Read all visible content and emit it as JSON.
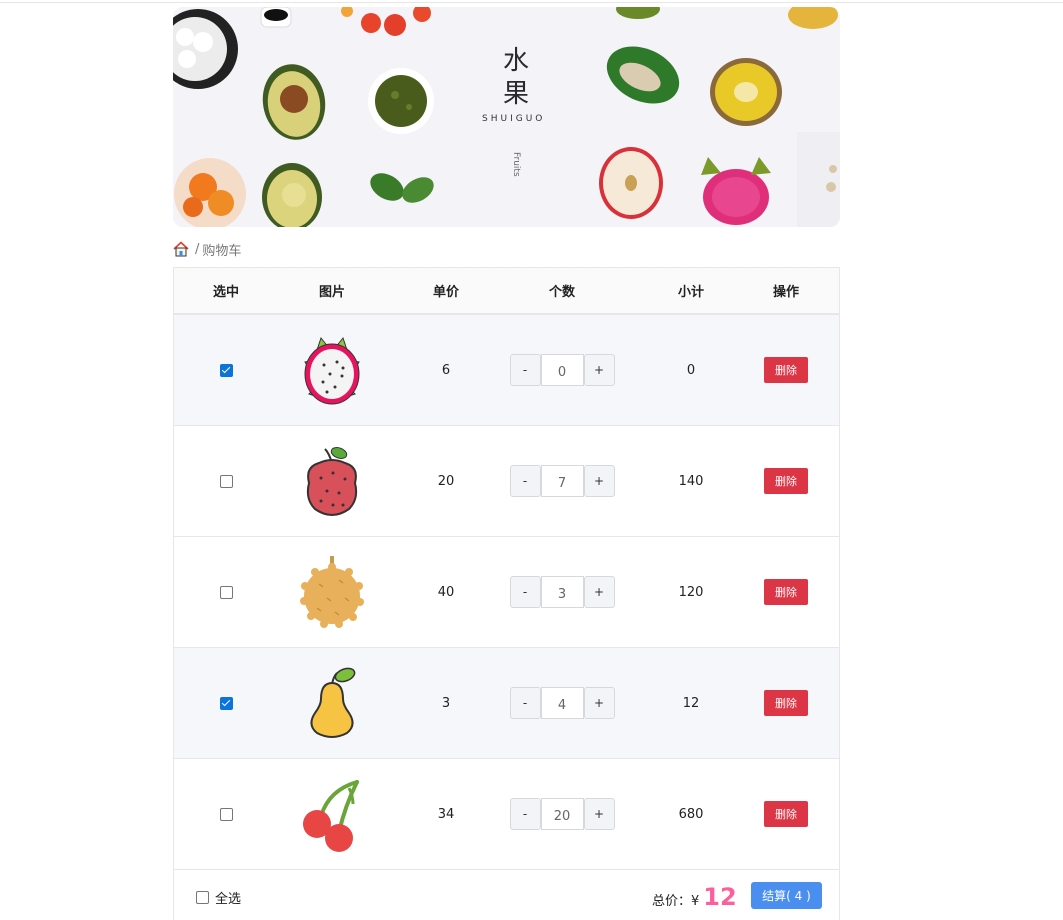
{
  "banner": {
    "title_line1": "水",
    "title_line2": "果",
    "subtitle": "SHUIGUO",
    "vertical_text": "Fruits"
  },
  "breadcrumb": {
    "home_icon": "home-icon",
    "separator": "/",
    "current": "购物车"
  },
  "table": {
    "headers": [
      "选中",
      "图片",
      "单价",
      "个数",
      "小计",
      "操作"
    ],
    "rows": [
      {
        "checked": true,
        "fruit": "dragon-fruit",
        "price": "6",
        "qty": "0",
        "subtotal": "0",
        "delete_label": "删除",
        "striped": true
      },
      {
        "checked": false,
        "fruit": "lychee",
        "price": "20",
        "qty": "7",
        "subtotal": "140",
        "delete_label": "删除",
        "striped": false
      },
      {
        "checked": false,
        "fruit": "durian",
        "price": "40",
        "qty": "3",
        "subtotal": "120",
        "delete_label": "删除",
        "striped": false
      },
      {
        "checked": true,
        "fruit": "pear",
        "price": "3",
        "qty": "4",
        "subtotal": "12",
        "delete_label": "删除",
        "striped": true
      },
      {
        "checked": false,
        "fruit": "cherry",
        "price": "34",
        "qty": "20",
        "subtotal": "680",
        "delete_label": "删除",
        "striped": false
      }
    ],
    "minus_label": "-",
    "plus_label": "+"
  },
  "footer": {
    "select_all_label": "全选",
    "select_all_checked": false,
    "total_label": "总价：¥",
    "total_amount": "12",
    "checkout_label": "结算( 4 )"
  },
  "colors": {
    "delete": "#dc3545",
    "checkout": "#4a8ff0",
    "total": "#ff5e9c",
    "stripe": "#f6f7fa"
  }
}
